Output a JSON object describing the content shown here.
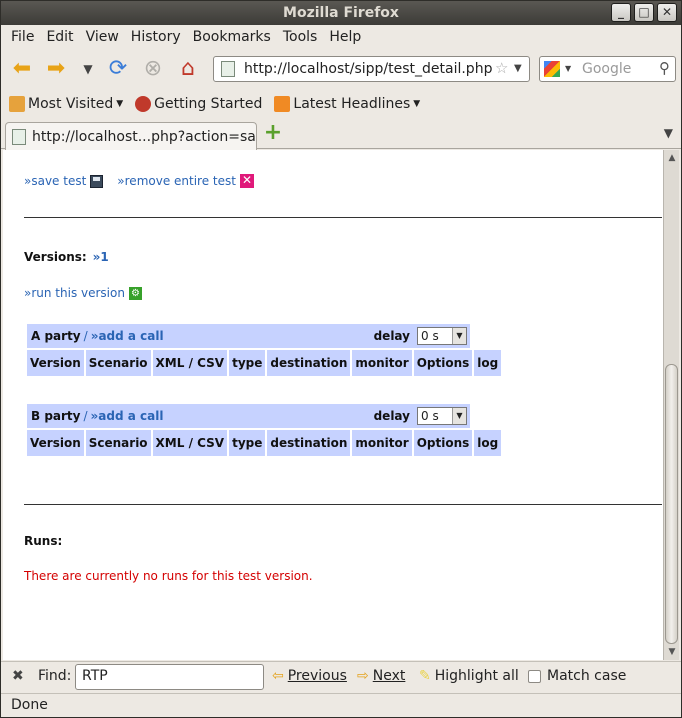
{
  "window": {
    "title": "Mozilla Firefox"
  },
  "menubar": {
    "items": [
      "File",
      "Edit",
      "View",
      "History",
      "Bookmarks",
      "Tools",
      "Help"
    ]
  },
  "navbar": {
    "url": "http://localhost/sipp/test_detail.php?action=save",
    "search_placeholder": "Google"
  },
  "bookmarks": {
    "items": [
      "Most Visited",
      "Getting Started",
      "Latest Headlines"
    ]
  },
  "tab": {
    "title": "http://localhost...php?action=save"
  },
  "page": {
    "save_test": "»save test",
    "remove_test": "»remove entire test",
    "versions_label": "Versions:",
    "version_link": "»1",
    "run_version": "»run this version",
    "parties": [
      {
        "name": "A party",
        "sep": "/",
        "add_call": "»add a call",
        "delay_label": "delay",
        "delay_value": "0 s"
      },
      {
        "name": "B party",
        "sep": "/",
        "add_call": "»add a call",
        "delay_label": "delay",
        "delay_value": "0 s"
      }
    ],
    "columns": [
      "Version",
      "Scenario",
      "XML / CSV",
      "type",
      "destination",
      "monitor",
      "Options",
      "log"
    ],
    "runs_label": "Runs:",
    "no_runs_msg": "There are currently no runs for this test version."
  },
  "findbar": {
    "label": "Find:",
    "value": "RTP",
    "previous": "Previous",
    "next": "Next",
    "highlight": "Highlight all",
    "match_case": "Match case"
  },
  "status": {
    "text": "Done"
  }
}
